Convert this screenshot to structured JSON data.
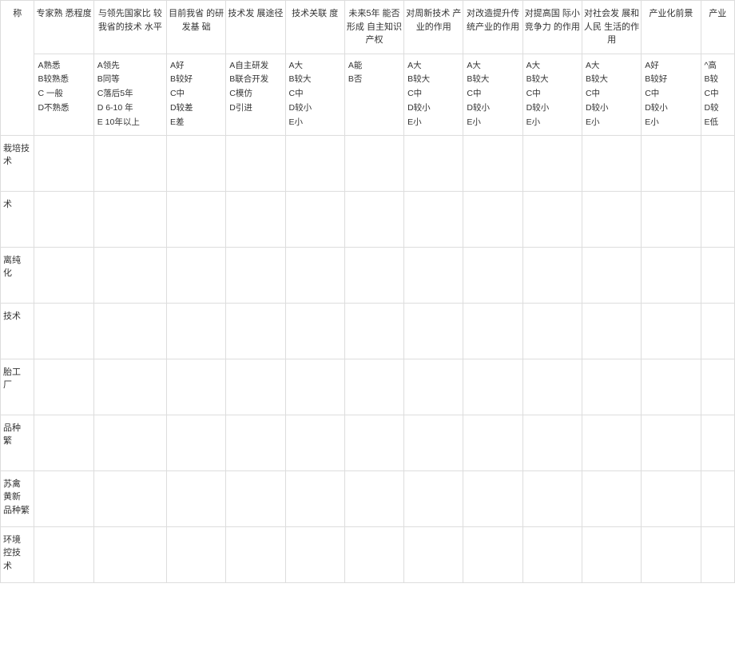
{
  "columnHeaders": [
    {
      "title": "称",
      "options": ""
    },
    {
      "title": "专家熟 悉程度",
      "options": "A熟悉\nB较熟悉\nC 一般\nD不熟悉"
    },
    {
      "title": "与领先国家比 较我省的技术 水平",
      "options": "A领先\nB同等\nC落后5年\nD 6-10 年\nE 10年以上"
    },
    {
      "title": "目前我省 的研发基 础",
      "options": "A好\nB较好\nC中\nD较差\nE差"
    },
    {
      "title": "技术发 展途径",
      "options": "A自主研发\nB联合开发\nC模仿\nD引进"
    },
    {
      "title": "技术关联 度",
      "options": "A大\nB较大\nC中\nD较小\nE小"
    },
    {
      "title": "未来5年 能否形成   自主知识 产权",
      "options": "A能\nB否"
    },
    {
      "title": "对周新技术 产业的作用",
      "options": "A大\nB较大\nC中\nD较小\nE小"
    },
    {
      "title": "对改造提升传统产业的作用",
      "options": "A大\nB较大\nC中\nD较小\nE小"
    },
    {
      "title": "对提高国 际小竞争力 的作用",
      "options": "A大\nB较大\nC中\nD较小\nE小"
    },
    {
      "title": "对社会发 展和人民 生活的作 用",
      "options": "A大\nB较大\nC中\nD较小\nE小"
    },
    {
      "title": "产业化前景",
      "options": "A好\nB较好\nC中\nD较小\nE小"
    },
    {
      "title": "产业",
      "options": "^高\nB较\nC中\nD较\nE低"
    }
  ],
  "rows": [
    {
      "label": "栽培技 术"
    },
    {
      "label": "术"
    },
    {
      "label": "离纯 化"
    },
    {
      "label": "技术"
    },
    {
      "label": "胎工 厂"
    },
    {
      "label": "品种 繁"
    },
    {
      "label": " 苏禽 黄新 品种繁"
    },
    {
      "label": " 环境 控技 术"
    }
  ]
}
